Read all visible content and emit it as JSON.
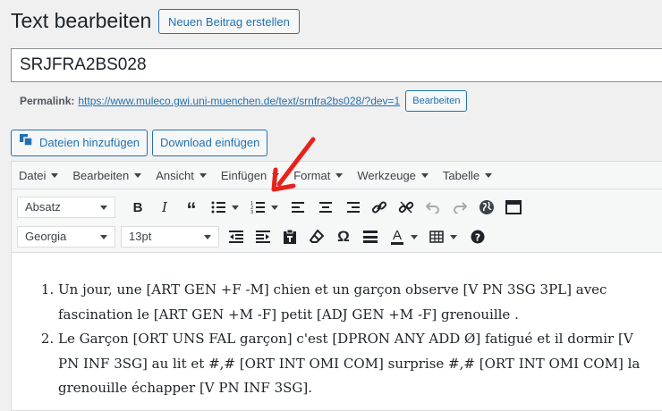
{
  "page": {
    "heading": "Text bearbeiten",
    "add_new_label": "Neuen Beitrag erstellen"
  },
  "post": {
    "title": "SRJFRA2BS028",
    "permalink_label": "Permalink:",
    "permalink_url": "https://www.muleco.gwi.uni-muenchen.de/text/srnfra2bs028/?dev=1",
    "edit_permalink_label": "Bearbeiten"
  },
  "media": {
    "add_media_label": "Dateien hinzufügen",
    "download_label": "Download einfügen"
  },
  "menubar": [
    "Datei",
    "Bearbeiten",
    "Ansicht",
    "Einfügen",
    "Format",
    "Werkzeuge",
    "Tabelle"
  ],
  "toolbar": {
    "format_select": "Absatz",
    "font_select": "Georgia",
    "size_select": "13pt"
  },
  "content": {
    "items": [
      "Un jour, une [ART GEN +F -M] chien et un garçon observe [V PN 3SG 3PL] avec fascination le [ART GEN +M -F] petit [ADJ GEN +M -F] grenouille .",
      "Le Garçon [ORT UNS FAL garçon] c'est [DPRON ANY ADD Ø] fatigué et il dormir [V PN INF 3SG] au lit et #,# [ORT INT OMI COM] surprise #,# [ORT INT OMI COM] la grenouille échapper [V PN INF 3SG]."
    ]
  },
  "colors": {
    "accent": "#2271b1",
    "annotation_arrow": "#e8221b"
  }
}
